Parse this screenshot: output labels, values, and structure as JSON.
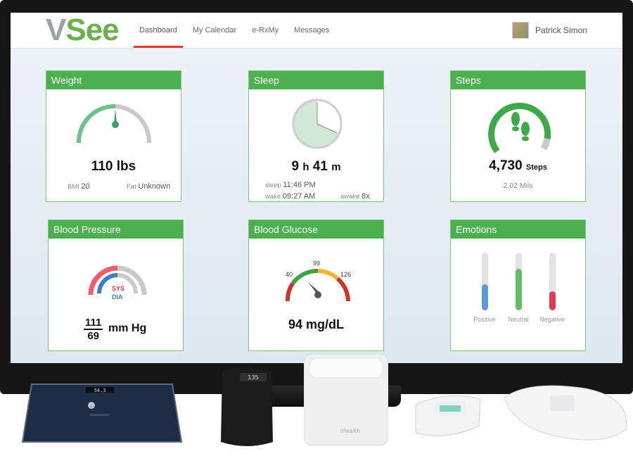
{
  "header": {
    "logo_v": "V",
    "logo_see": "See",
    "nav": [
      "Dashboard",
      "My Calendar",
      "e-RxMy",
      "Messages"
    ],
    "user_name": "Patrick Simon"
  },
  "weight": {
    "title": "Weight",
    "value": "110",
    "unit": "lbs",
    "bmi_label": "BMI",
    "bmi_value": "20",
    "fat_label": "Fat",
    "fat_value": "Unknown"
  },
  "sleep": {
    "title": "Sleep",
    "hours": "9",
    "h": "h",
    "minutes": "41",
    "m": "m",
    "sleep_label": "sleep",
    "sleep_time": "11:46 PM",
    "wake_label": "wake",
    "wake_time": "09:27 AM",
    "awake_label": "awake",
    "awake_value": "8x"
  },
  "steps": {
    "title": "Steps",
    "value": "4,730",
    "unit": "Steps",
    "distance": "2.02 Mils"
  },
  "bp": {
    "title": "Blood Pressure",
    "sys_label": "SYS",
    "dia_label": "DIA",
    "systolic": "111",
    "diastolic": "69",
    "unit": "mm Hg"
  },
  "glucose": {
    "title": "Blood Glucose",
    "tick_low": "40",
    "tick_mid": "99",
    "tick_high": "126",
    "value": "94 mg/dL"
  },
  "emotions": {
    "title": "Emotions",
    "bars": [
      {
        "label": "Positive",
        "level": 0.45,
        "color": "#5b9bd5"
      },
      {
        "label": "Neutral",
        "level": 0.72,
        "color": "#66bb6a"
      },
      {
        "label": "Negative",
        "level": 0.33,
        "color": "#e53950"
      }
    ]
  },
  "devices": {
    "bp_monitor_brand": "iHealth",
    "band_display": "135",
    "scale_display": "54.3"
  }
}
